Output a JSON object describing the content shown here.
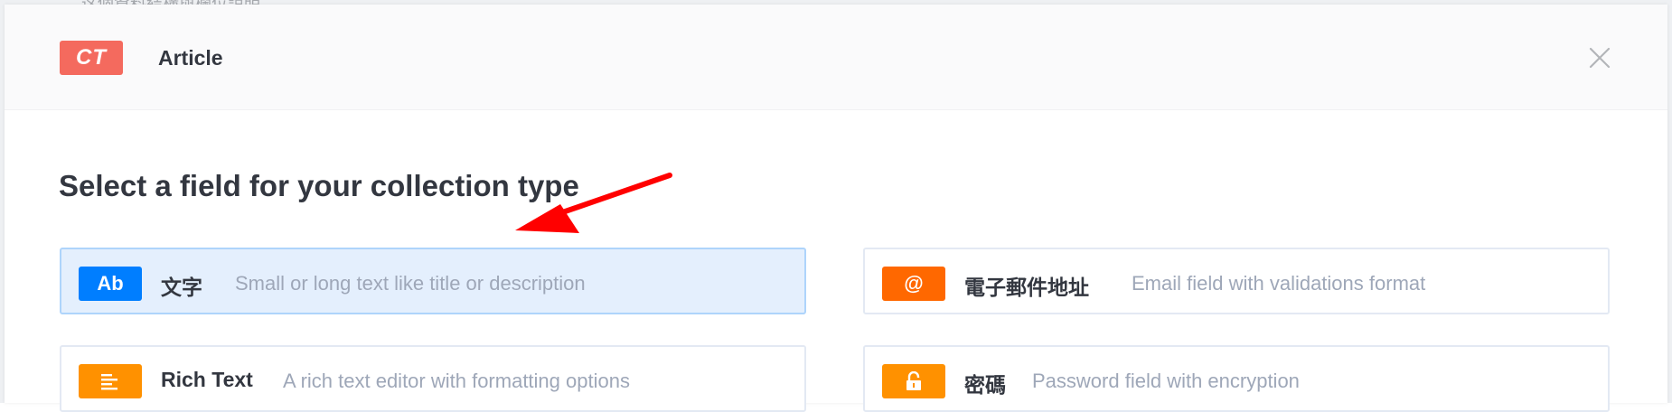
{
  "background": {
    "partial_text": "这個資料結構與欄位說明"
  },
  "modal": {
    "badge": "CT",
    "title": "Article",
    "close_icon": "close-icon",
    "section_title": "Select a field for your collection type"
  },
  "fields": [
    {
      "icon_text": "Ab",
      "name": "文字",
      "description": "Small or long text like title or description",
      "icon_color": "#007eff",
      "selected": true
    },
    {
      "icon_text": "@",
      "name": "電子郵件地址",
      "description": "Email field with validations format",
      "icon_color": "#ff6800",
      "selected": false
    },
    {
      "icon_text": "",
      "icon": "align-left-icon",
      "name": "Rich Text",
      "description": "A rich text editor with formatting options",
      "icon_color": "#ff9100",
      "selected": false
    },
    {
      "icon_text": "",
      "icon": "unlock-icon",
      "name": "密碼",
      "description": "Password field with encryption",
      "icon_color": "#ff9100",
      "selected": false
    }
  ],
  "colors": {
    "badge_bg": "#f46a5e",
    "annotation_arrow": "#ff0000"
  }
}
